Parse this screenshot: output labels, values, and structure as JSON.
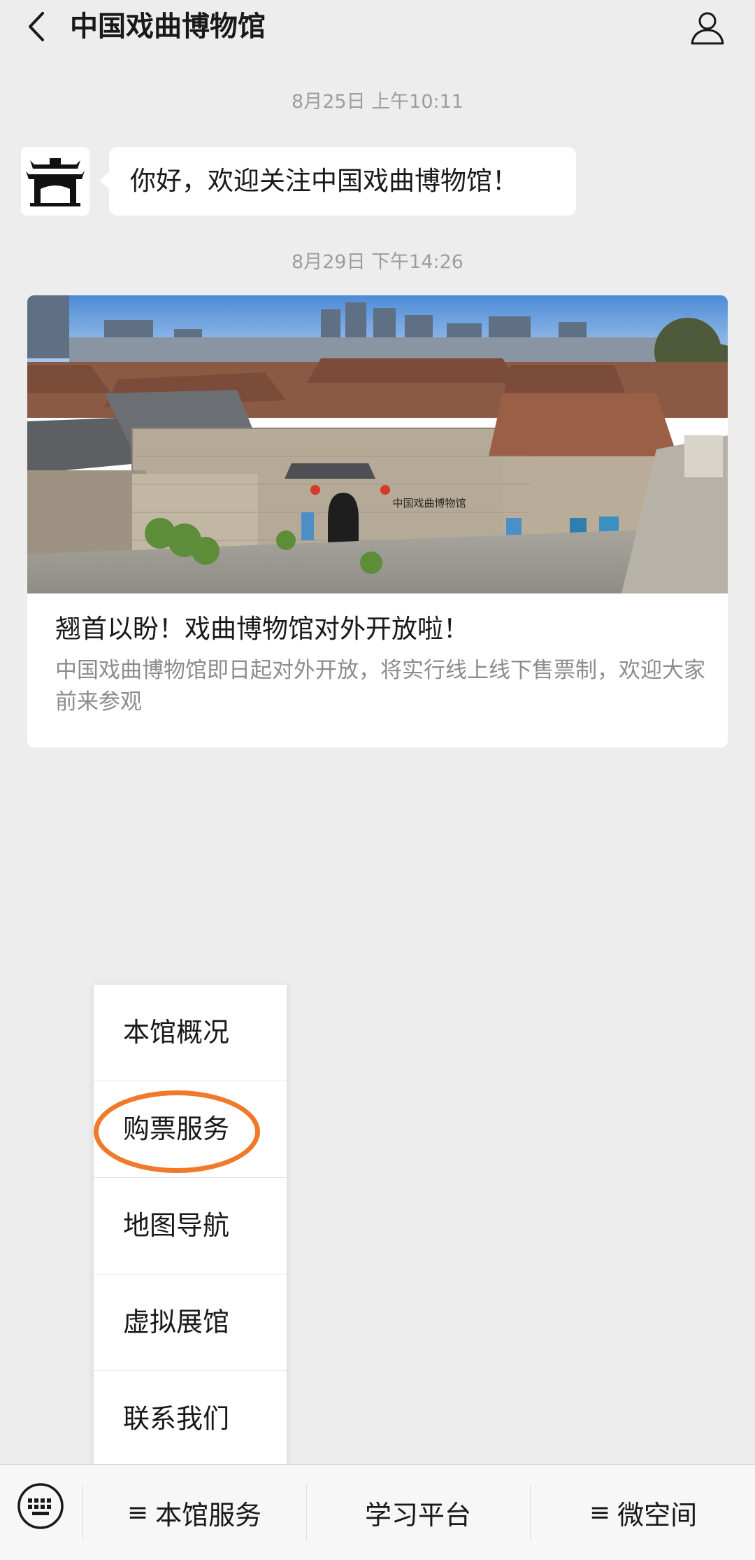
{
  "header": {
    "title": "中国戏曲博物馆"
  },
  "timestamps": [
    "8月25日 上午10:11",
    "8月29日 下午14:26"
  ],
  "message": {
    "text": "你好，欢迎关注中国戏曲博物馆！"
  },
  "article": {
    "title": "翘首以盼！戏曲博物馆对外开放啦！",
    "description": "中国戏曲博物馆即日起对外开放，将实行线上线下售票制，欢迎大家前来参观",
    "image_sign_text": "中国戏曲博物馆"
  },
  "popup_menu": {
    "items": [
      {
        "label": "本馆概况"
      },
      {
        "label": "购票服务"
      },
      {
        "label": "地图导航"
      },
      {
        "label": "虚拟展馆"
      },
      {
        "label": "联系我们"
      }
    ],
    "highlighted_index": 1,
    "highlight_color": "#f07a2a"
  },
  "bottom_menu": {
    "menu_glyph": "≡",
    "items": [
      {
        "label": "本馆服务",
        "has_submenu": true
      },
      {
        "label": "学习平台",
        "has_submenu": false
      },
      {
        "label": "微空间",
        "has_submenu": true
      }
    ]
  },
  "icons": {
    "back": "chevron-left-icon",
    "profile": "person-icon",
    "keyboard": "keyboard-icon"
  }
}
